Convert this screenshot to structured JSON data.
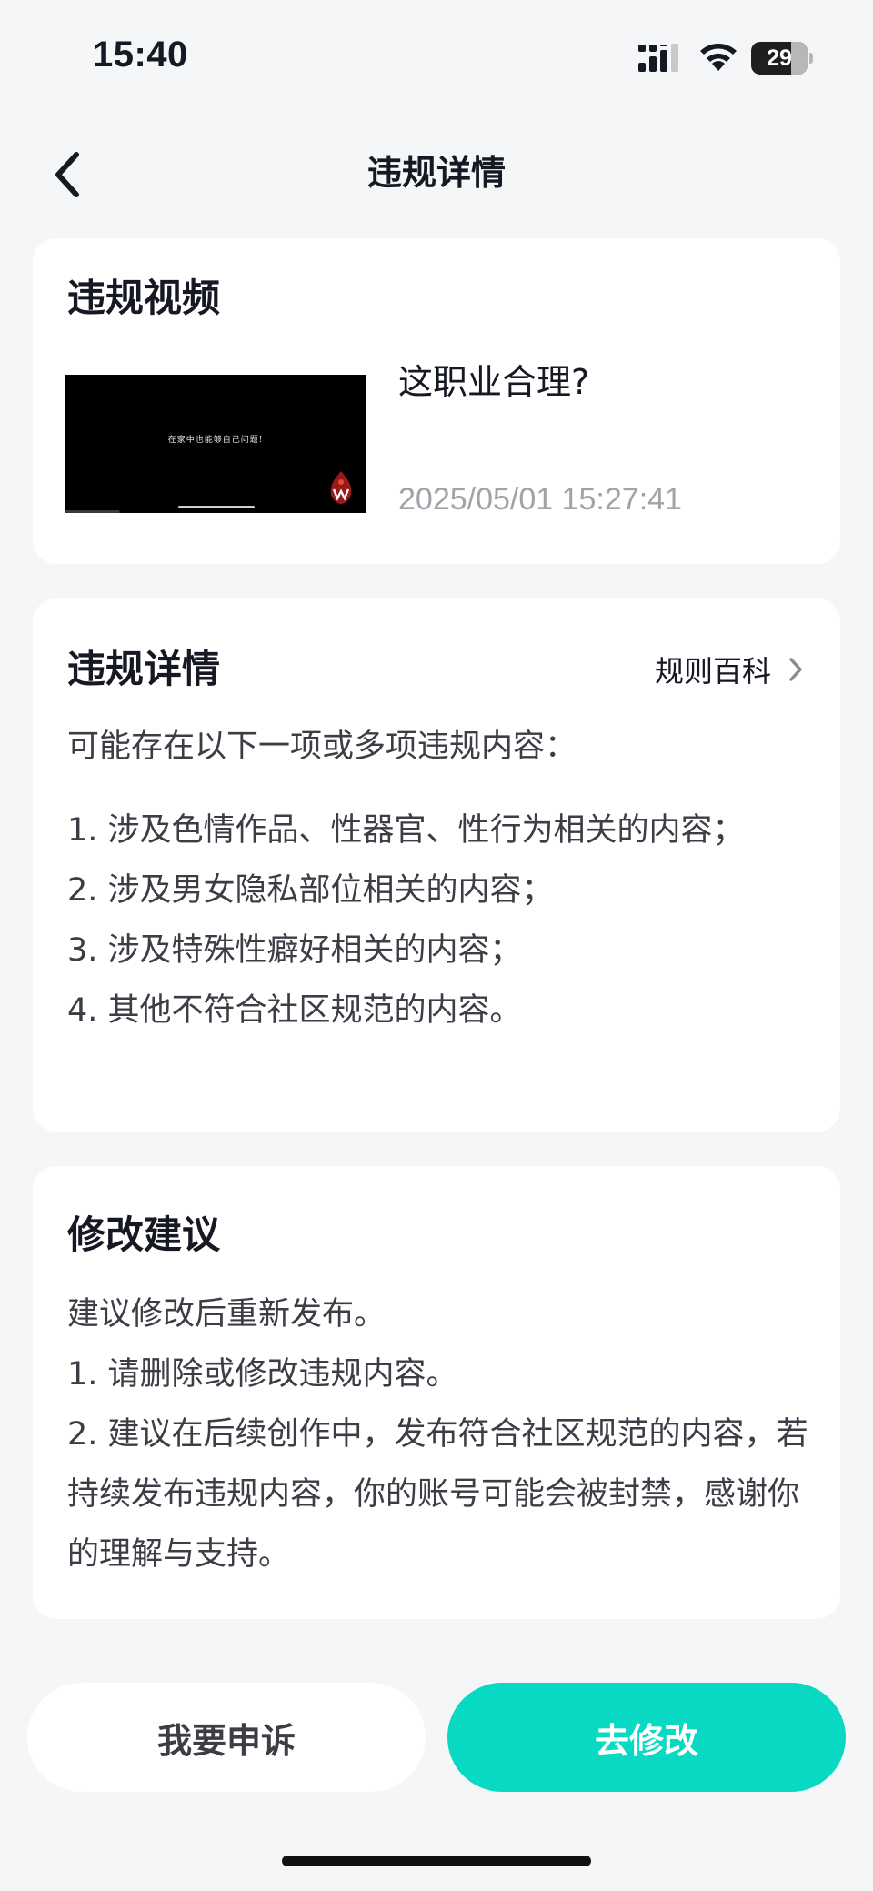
{
  "status_bar": {
    "time": "15:40",
    "battery": {
      "level_percent": 29,
      "label": "29"
    }
  },
  "nav": {
    "title": "违规详情",
    "back_icon": "chevron-left-icon"
  },
  "video_card": {
    "heading": "违规视频",
    "thumbnail_caption": "在家中也能够自己问题!",
    "title": "这职业合理?",
    "timestamp": "2025/05/01 15:27:41"
  },
  "detail_card": {
    "heading": "违规详情",
    "rules_link": {
      "label": "规则百科",
      "icon": "chevron-right-icon"
    },
    "intro": "可能存在以下一项或多项违规内容：",
    "items": [
      "1. 涉及色情作品、性器官、性行为相关的内容；",
      "2. 涉及男女隐私部位相关的内容；",
      "3. 涉及特殊性癖好相关的内容；",
      "4. 其他不符合社区规范的内容。"
    ]
  },
  "suggest_card": {
    "heading": "修改建议",
    "lines": [
      "建议修改后重新发布。",
      "1. 请删除或修改违规内容。",
      "2. 建议在后续创作中，发布符合社区规范的内容，若持续发布违规内容，你的账号可能会被封禁，感谢你的理解与支持。"
    ]
  },
  "actions": {
    "appeal_label": "我要申诉",
    "edit_label": "去修改",
    "edit_color": "#08d9c2"
  }
}
